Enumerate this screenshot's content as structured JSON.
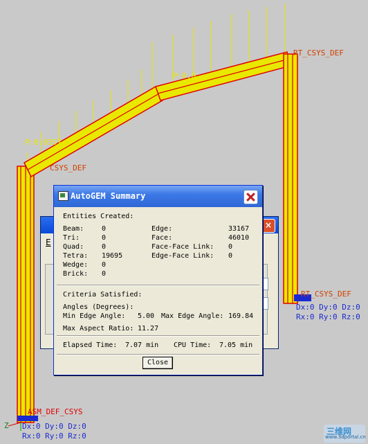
{
  "viewport": {
    "label_p1": "P:0.0357",
    "label_p2": "P:0.0",
    "label_csys_left": "CSYS_DEF",
    "label_csys_top_right": "RT_CSYS_DEF",
    "label_csys_right": "RT_CSYS_DEF",
    "label_csys_bottom": "ASM_DEF_CSYS",
    "right_constraint_line1": "Dx:0 Dy:0 Dz:0",
    "right_constraint_line2": "Rx:0 Ry:0 Rz:0",
    "bottom_constraint_line1": "Dx:0 Dy:0 Dz:0",
    "bottom_constraint_line2": "Rx:0 Ry:0 Rz:0",
    "axis_z": "Z"
  },
  "background_dialog": {
    "fragment_label": "E"
  },
  "dialog": {
    "title": "AutoGEM Summary",
    "entities_header": "Entities Created:",
    "entities": {
      "beam_label": "Beam:",
      "beam_value": "0",
      "tri_label": "Tri:",
      "tri_value": "0",
      "quad_label": "Quad:",
      "quad_value": "0",
      "tetra_label": "Tetra:",
      "tetra_value": "19695",
      "wedge_label": "Wedge:",
      "wedge_value": "0",
      "brick_label": "Brick:",
      "brick_value": "0",
      "edge_label": "Edge:",
      "edge_value": "33167",
      "face_label": "Face:",
      "face_value": "46010",
      "face_face_label": "Face-Face Link:",
      "face_face_value": "0",
      "edge_face_label": "Edge-Face Link:",
      "edge_face_value": "0"
    },
    "criteria_header": "Criteria Satisfied:",
    "angles_label": "Angles (Degrees):",
    "min_edge_label": "Min Edge Angle:",
    "min_edge_value": "5.00",
    "max_edge_label": "Max Edge Angle:",
    "max_edge_value": "169.84",
    "max_aspect_label": "Max Aspect Ratio:",
    "max_aspect_value": "11.27",
    "elapsed_label": "Elapsed Time:",
    "elapsed_value": "7.07 min",
    "cpu_label": "CPU Time:",
    "cpu_value": "7.05 min",
    "close_label": "Close"
  },
  "watermark": {
    "text": "三维网",
    "url": "www.3dportal.cn"
  },
  "colors": {
    "model_wire": "#e8e800",
    "mesh_red": "#e00000",
    "csys_label": "#d04000",
    "constraint_blue": "#1a2ad0"
  }
}
